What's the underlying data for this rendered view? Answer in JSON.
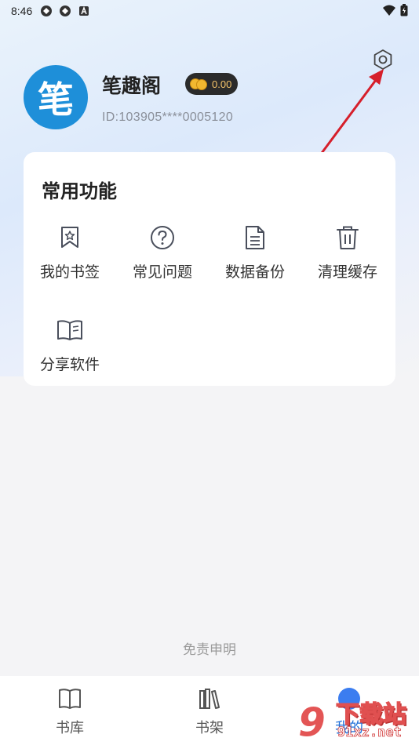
{
  "status_bar": {
    "time": "8:46"
  },
  "profile": {
    "avatar_char": "笔",
    "username": "笔趣阁",
    "coin_balance": "0.00",
    "user_id": "ID:103905****0005120"
  },
  "functions": {
    "title": "常用功能",
    "items": [
      {
        "label": "我的书签",
        "icon": "bookmark-icon"
      },
      {
        "label": "常见问题",
        "icon": "question-icon"
      },
      {
        "label": "数据备份",
        "icon": "document-icon"
      },
      {
        "label": "清理缓存",
        "icon": "trash-icon"
      },
      {
        "label": "分享软件",
        "icon": "open-book-icon"
      }
    ]
  },
  "disclaimer": "免责申明",
  "bottom_nav": {
    "items": [
      {
        "label": "书库",
        "icon": "book-icon"
      },
      {
        "label": "书架",
        "icon": "bookshelf-icon"
      },
      {
        "label": "我的",
        "icon": "profile-icon"
      }
    ],
    "active_index": 2
  },
  "watermark": {
    "logo": "9",
    "text": "下载站",
    "url": "91xz.net"
  },
  "colors": {
    "accent": "#1e8fd9",
    "annotation_arrow": "#d61f2b",
    "coin": "#f2b830"
  }
}
